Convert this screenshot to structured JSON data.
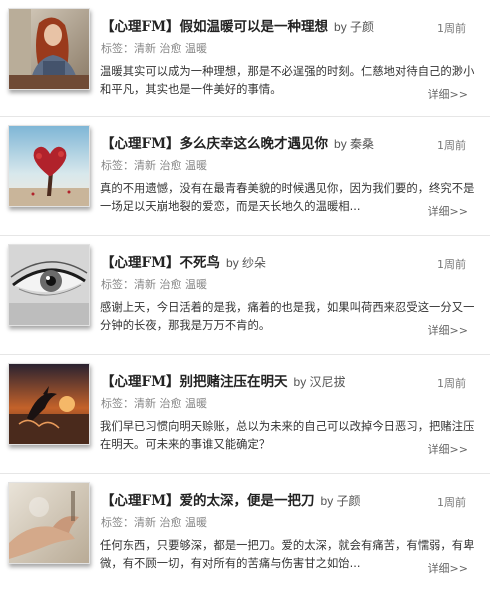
{
  "tag_label": "标签：",
  "time_label": "1周前",
  "more_label": "详细>>",
  "articles": [
    {
      "title": "【心理FM】假如温暖可以是一种理想",
      "author": "by 子颜",
      "tags": [
        "清新",
        "治愈",
        "温暖"
      ],
      "summary": "温暖其实可以成为一种理想，那是不必逞强的时刻。仁慈地对待自己的渺小和平凡，其实也是一件美好的事情。",
      "thumb": "girl-portrait"
    },
    {
      "title": "【心理FM】多么庆幸这么晚才遇见你",
      "author": "by 秦桑",
      "tags": [
        "清新",
        "治愈",
        "温暖"
      ],
      "summary": "真的不用遗憾，没有在最青春美貌的时候遇见你，因为我们要的，终究不是一场足以天崩地裂的爱恋，而是天长地久的温暖相...",
      "thumb": "heart-tree"
    },
    {
      "title": "【心理FM】不死鸟",
      "author": "by 纱朵",
      "tags": [
        "清新",
        "治愈",
        "温暖"
      ],
      "summary": "感谢上天，今日活着的是我，痛着的也是我，如果叫荷西来忍受这一分又一分钟的长夜，那我是万万不肯的。",
      "thumb": "eye"
    },
    {
      "title": "【心理FM】别把赌注压在明天",
      "author": "by 汉尼拔",
      "tags": [
        "清新",
        "治愈",
        "温暖"
      ],
      "summary": "我们早已习惯向明天赊账，总以为未来的自己可以改掉今日恶习，把赌注压在明天。可未来的事谁又能确定？",
      "thumb": "dolphin-sunset"
    },
    {
      "title": "【心理FM】爱的太深，便是一把刀",
      "author": "by 子颜",
      "tags": [
        "清新",
        "治愈",
        "温暖"
      ],
      "summary": "任何东西，只要够深，都是一把刀。爱的太深，就会有痛苦，有懦弱，有卑微，有不顾一切，有对所有的苦痛与伤害甘之如饴...",
      "thumb": "hands"
    }
  ]
}
